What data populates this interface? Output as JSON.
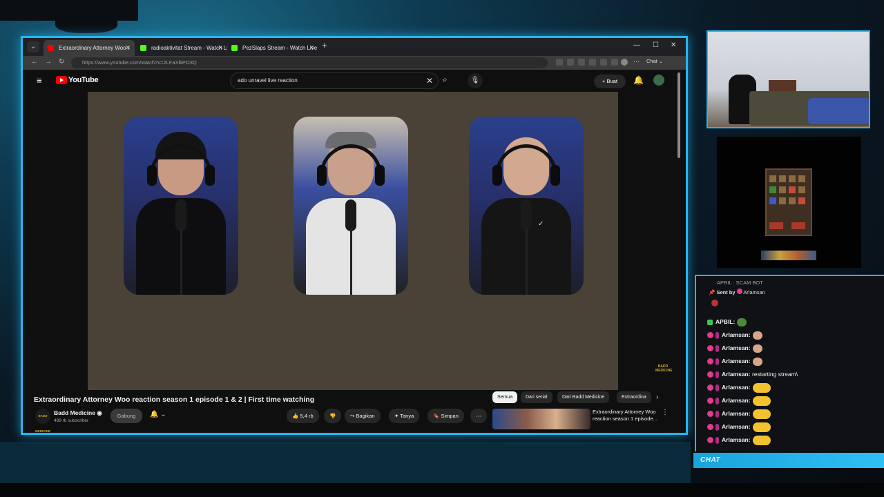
{
  "browser": {
    "tabs": [
      {
        "label": "Extraordinary Attorney Woo r",
        "active": true,
        "favicon_color": "#ff0000"
      },
      {
        "label": "radioaktivitat Stream - Watch Live",
        "active": false,
        "favicon_color": "#53fc18"
      },
      {
        "label": "PezSlaps Stream - Watch Live on K",
        "active": false,
        "favicon_color": "#53fc18"
      }
    ],
    "url": "https://www.youtube.com/watch?v=2LFaXlkPO3Q",
    "chat_button": "Chat"
  },
  "youtube": {
    "logo_text": "YouTube",
    "search_value": "ado unravel live reaction",
    "create_label": "Buat",
    "watermark": "BADD MEDICINE",
    "video_title": "Extraordinary Attorney Woo reaction season 1 episode 1 & 2 | First time watching",
    "channel": {
      "name": "Badd Medicine",
      "subscribers": "489 rb subscriber",
      "avatar_text": "BADD MEDICINE"
    },
    "join_label": "Gabung",
    "actions": {
      "likes": "5,4 rb",
      "share": "Bagikan",
      "ask": "Tanya",
      "save": "Simpan"
    },
    "chips": [
      "Semua",
      "Dari serial",
      "Dari Badd Medicine",
      "Extraordina"
    ],
    "recommended": {
      "title": "Extraordinary Attorney Woo reaction season 1 episode..."
    }
  },
  "chat": {
    "header_partial": "APRIL : SCAM BOT",
    "sent_by_prefix": "Sent by",
    "sent_by_user": "Arlamsan",
    "messages": [
      {
        "user": "APBIL:",
        "text": "",
        "emote": "pepe",
        "badge": "green"
      },
      {
        "user": "Arlamsan:",
        "text": "",
        "emote": "fist",
        "badge": "sub"
      },
      {
        "user": "Arlamsan:",
        "text": "",
        "emote": "fist",
        "badge": "sub"
      },
      {
        "user": "Arlamsan:",
        "text": "",
        "emote": "fist",
        "badge": "sub"
      },
      {
        "user": "Arlamsan:",
        "text": "restarting stream\\",
        "emote": "",
        "badge": "sub"
      },
      {
        "user": "Arlamsan:",
        "text": "",
        "emote": "yellow",
        "badge": "sub"
      },
      {
        "user": "Arlamsan:",
        "text": "",
        "emote": "yellow",
        "badge": "sub"
      },
      {
        "user": "Arlamsan:",
        "text": "",
        "emote": "yellow",
        "badge": "sub"
      },
      {
        "user": "Arlamsan:",
        "text": "",
        "emote": "yellow",
        "badge": "sub"
      },
      {
        "user": "Arlamsan:",
        "text": "",
        "emote": "yellow",
        "badge": "sub"
      }
    ],
    "label": "CHAT"
  },
  "colors": {
    "accent": "#27b6f0",
    "yt_red": "#ff0000",
    "kick_green": "#53fc18"
  }
}
